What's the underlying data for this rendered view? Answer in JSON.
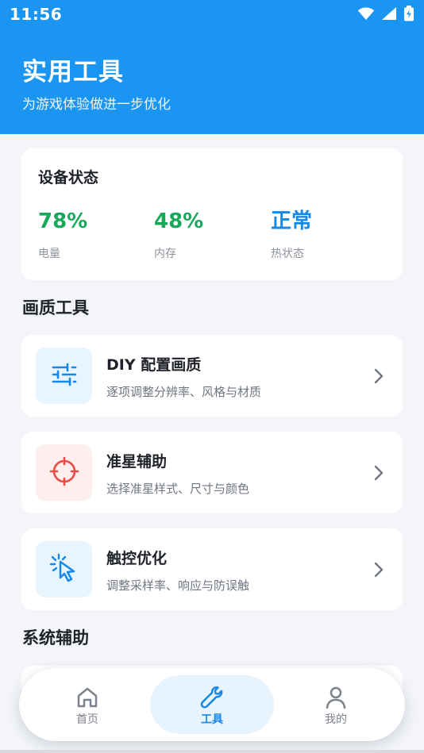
{
  "status_bar": {
    "time": "11:56",
    "icons": [
      "wifi-icon",
      "signal-icon",
      "battery-charging-icon"
    ]
  },
  "header": {
    "title": "实用工具",
    "subtitle": "为游戏体验做进一步优化"
  },
  "device_status": {
    "title": "设备状态",
    "metrics": [
      {
        "value": "78%",
        "label": "电量",
        "color": "#17a85a"
      },
      {
        "value": "48%",
        "label": "内存",
        "color": "#17a85a"
      },
      {
        "value": "正常",
        "label": "热状态",
        "color": "#1688e9"
      }
    ]
  },
  "sections": {
    "image_tools": "画质工具",
    "system_assist": "系统辅助"
  },
  "tools": [
    {
      "title": "DIY 配置画质",
      "description": "逐项调整分辨率、风格与材质",
      "icon": "sliders-icon"
    },
    {
      "title": "准星辅助",
      "description": "选择准星样式、尺寸与颜色",
      "icon": "crosshair-icon"
    },
    {
      "title": "触控优化",
      "description": "调整采样率、响应与防误触",
      "icon": "touch-click-icon"
    }
  ],
  "bottom_nav": [
    {
      "label": "首页",
      "icon": "home-icon",
      "active": false
    },
    {
      "label": "工具",
      "icon": "wrench-icon",
      "active": true
    },
    {
      "label": "我的",
      "icon": "user-icon",
      "active": false
    }
  ],
  "colors": {
    "primary": "#1a95f2",
    "active": "#1688e9",
    "success": "#17a85a",
    "danger": "#e94b45",
    "background": "#f3f5f9"
  }
}
